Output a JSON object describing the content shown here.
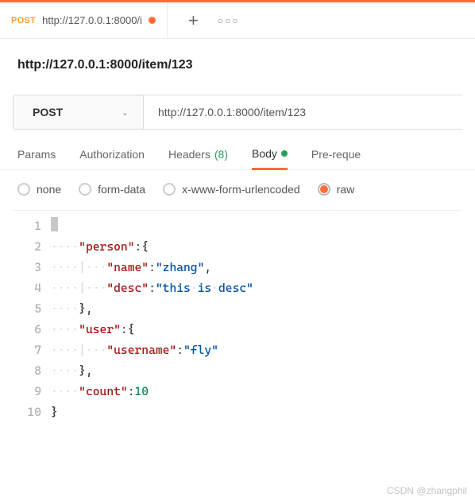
{
  "colors": {
    "accent": "#ff6c37",
    "success": "#2a9d5c"
  },
  "tab": {
    "method": "POST",
    "url_short": "http://127.0.0.1:8000/i",
    "has_unsaved": true
  },
  "title": "http://127.0.0.1:8000/item/123",
  "request": {
    "method": "POST",
    "url": "http://127.0.0.1:8000/item/123"
  },
  "tabs": {
    "params": "Params",
    "auth": "Authorization",
    "headers": "Headers",
    "headers_count": "(8)",
    "body": "Body",
    "pre": "Pre-reque"
  },
  "body_types": {
    "none": "none",
    "form_data": "form-data",
    "urlencoded": "x-www-form-urlencoded",
    "raw": "raw"
  },
  "editor": {
    "line_numbers": [
      "1",
      "2",
      "3",
      "4",
      "5",
      "6",
      "7",
      "8",
      "9",
      "10"
    ],
    "json_body": {
      "person": {
        "name": "zhang",
        "desc": "this is desc"
      },
      "user": {
        "username": "fly"
      },
      "count": 10
    }
  },
  "watermark": "CSDN @zhangphil"
}
